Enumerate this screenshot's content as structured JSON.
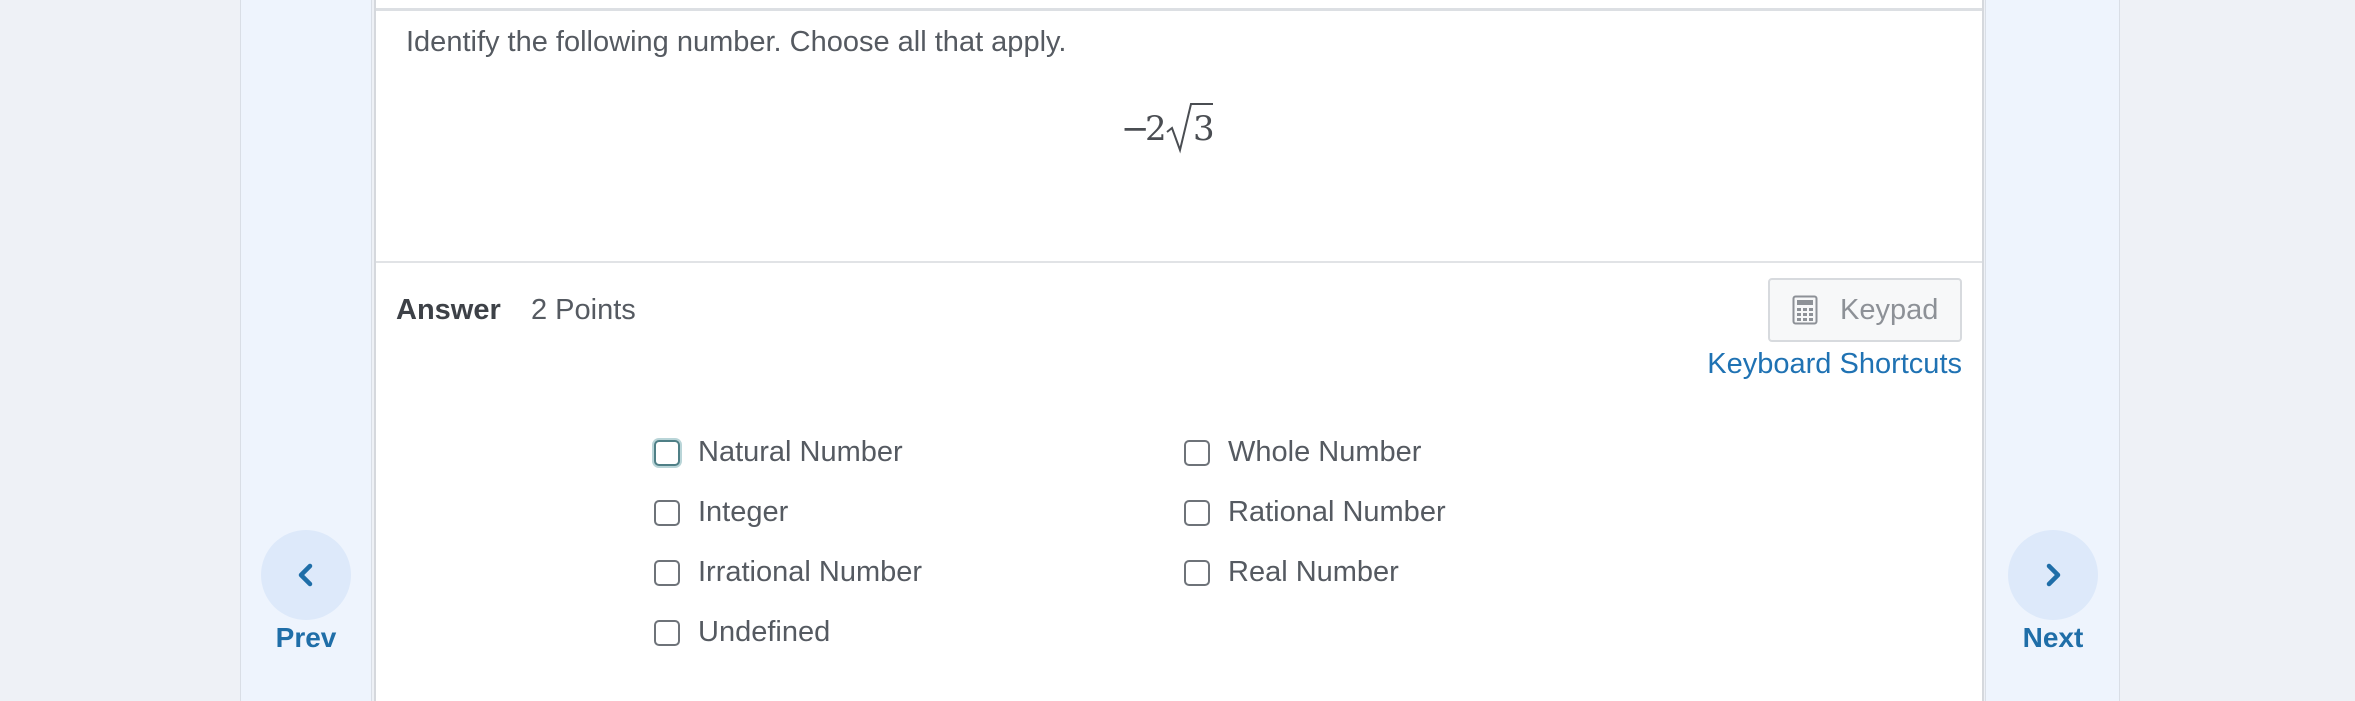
{
  "navigation": {
    "prev_label": "Prev",
    "next_label": "Next"
  },
  "question": {
    "prompt": "Identify the following number. Choose all that apply.",
    "expression": {
      "sign": "−",
      "coefficient": "2",
      "radicand": "3"
    }
  },
  "answer": {
    "label": "Answer",
    "points": "2 Points"
  },
  "toolbar": {
    "keypad_label": "Keypad",
    "shortcuts_label": "Keyboard Shortcuts"
  },
  "options": [
    {
      "label": "Natural Number",
      "checked": false,
      "focused": true
    },
    {
      "label": "Whole Number",
      "checked": false
    },
    {
      "label": "Integer",
      "checked": false
    },
    {
      "label": "Rational Number",
      "checked": false
    },
    {
      "label": "Irrational Number",
      "checked": false
    },
    {
      "label": "Real Number",
      "checked": false
    },
    {
      "label": "Undefined",
      "checked": false
    }
  ],
  "colors": {
    "accent": "#1f72b3",
    "nav_circle": "#dde9fa",
    "side_bg": "#eef4fd"
  }
}
